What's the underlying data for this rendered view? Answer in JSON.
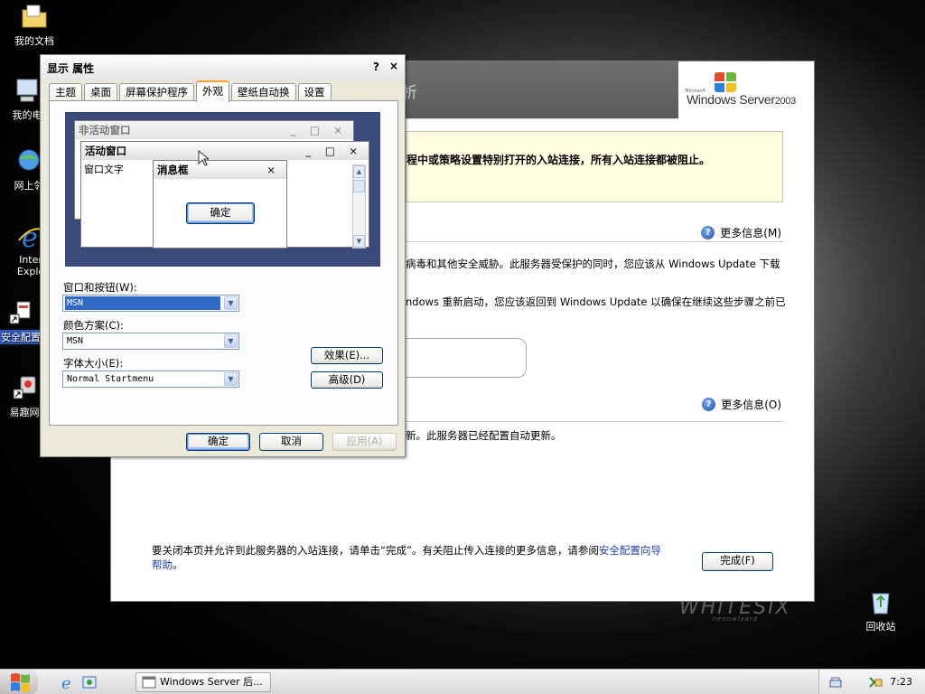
{
  "desktop": {
    "icons": [
      {
        "label": "我的文档"
      },
      {
        "label": "我的电"
      },
      {
        "label": "网上邻"
      },
      {
        "label": "Inter"
      },
      {
        "label": "Explo"
      },
      {
        "label": "安全配置"
      },
      {
        "label": "易趣网"
      },
      {
        "label": "回收站"
      }
    ],
    "watermark": "WHITESIX",
    "watermark_sub": "neonwizard"
  },
  "background_window": {
    "title_fragment": "析",
    "logo": {
      "microsoft": "Microsoft",
      "brand": "Windows Server",
      "year": "2003"
    },
    "warning": "程中或策略设置特别打开的入站连接，所有入站连接都被阻止。",
    "more_info_1": "更多信息(M)",
    "para_1": "病毒和其他安全威胁。此服务器受保护的同时，您应该从 Windows Update 下载",
    "para_2": "ndows 重新启动，您应该返回到 Windows Update 以确保在继续这些步骤之前已",
    "more_info_2": "更多信息(O)",
    "para_3": "新。此服务器已经配置自动更新。",
    "footer_1": "要关闭本页并允许到此服务器的入站连接，请单击“完成”。有关阻止传入连接的更多信息，请参阅",
    "footer_link_1": "安全配置向导",
    "footer_link_2": "帮助",
    "footer_period": "。",
    "done_button": "完成(F)"
  },
  "dialog": {
    "title": "显示 属性",
    "help": "?",
    "close": "×",
    "tabs": [
      "主题",
      "桌面",
      "屏幕保护程序",
      "外观",
      "壁纸自动换",
      "设置"
    ],
    "active_tab": "外观",
    "preview": {
      "inactive_title": "非活动窗口",
      "active_title": "活动窗口",
      "window_text": "窗口文字",
      "msgbox_title": "消息框",
      "msgbox_ok": "确定",
      "controls": "_ □ ×",
      "close": "×"
    },
    "windows_buttons_label": "窗口和按钮(W):",
    "windows_buttons_value": "MSN",
    "color_scheme_label": "颜色方案(C):",
    "color_scheme_value": "MSN",
    "font_size_label": "字体大小(E):",
    "font_size_value": "Normal Startmenu",
    "effects_button": "效果(E)...",
    "advanced_button": "高级(D)",
    "ok_button": "确定",
    "cancel_button": "取消",
    "apply_button": "应用(A)"
  },
  "taskbar": {
    "task_label": "Windows Server 后...",
    "clock": "7:23"
  },
  "colors": {
    "selection": "#316ac5",
    "link": "#1e3fa7",
    "warning_bg": "#fffee0",
    "dialog_bg": "#ece9d8"
  }
}
